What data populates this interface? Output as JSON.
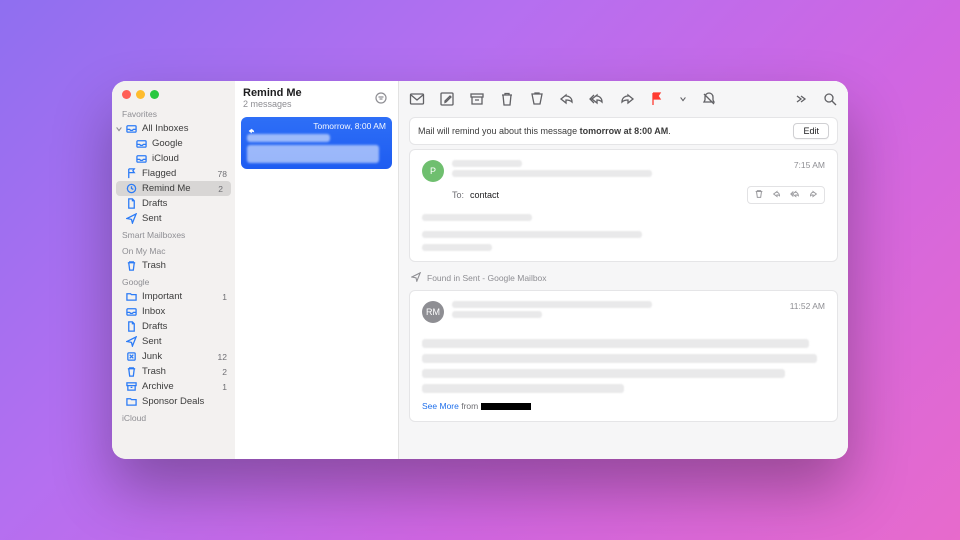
{
  "header": {
    "title": "Remind Me",
    "subtitle": "2 messages"
  },
  "sidebar": {
    "sections": [
      {
        "label": "Favorites"
      },
      {
        "label": "Smart Mailboxes"
      },
      {
        "label": "On My Mac"
      },
      {
        "label": "Google"
      },
      {
        "label": "iCloud"
      }
    ],
    "favorites": [
      {
        "label": "All Inboxes",
        "icon": "tray-icon",
        "expanded": true
      },
      {
        "label": "Google",
        "icon": "tray-icon",
        "indent": true
      },
      {
        "label": "iCloud",
        "icon": "tray-icon",
        "indent": true
      },
      {
        "label": "Flagged",
        "icon": "flag-icon",
        "count": "78"
      },
      {
        "label": "Remind Me",
        "icon": "clock-icon",
        "count": "2",
        "selected": true
      },
      {
        "label": "Drafts",
        "icon": "doc-icon"
      },
      {
        "label": "Sent",
        "icon": "plane-icon"
      }
    ],
    "onmymac": [
      {
        "label": "Trash",
        "icon": "trash-icon"
      }
    ],
    "google": [
      {
        "label": "Important",
        "icon": "folder-icon",
        "count": "1"
      },
      {
        "label": "Inbox",
        "icon": "tray-icon"
      },
      {
        "label": "Drafts",
        "icon": "doc-icon"
      },
      {
        "label": "Sent",
        "icon": "plane-icon"
      },
      {
        "label": "Junk",
        "icon": "junk-icon",
        "count": "12"
      },
      {
        "label": "Trash",
        "icon": "trash-icon",
        "count": "2"
      },
      {
        "label": "Archive",
        "icon": "archive-icon",
        "count": "1"
      },
      {
        "label": "Sponsor Deals",
        "icon": "folder-icon"
      }
    ]
  },
  "msglist": {
    "items": [
      {
        "time": "Tomorrow, 8:00 AM",
        "selected": true
      }
    ]
  },
  "remind_banner": {
    "prefix": "Mail will remind you about this message ",
    "bold": "tomorrow at 8:00 AM",
    "suffix": ".",
    "edit": "Edit"
  },
  "message1": {
    "avatar": "P",
    "time": "7:15 AM",
    "to_label": "To:",
    "to_value": "contact"
  },
  "found_bar": "Found in Sent - Google Mailbox",
  "message2": {
    "avatar": "RM",
    "time": "11:52 AM",
    "seemore_link": "See More",
    "seemore_from": " from "
  }
}
